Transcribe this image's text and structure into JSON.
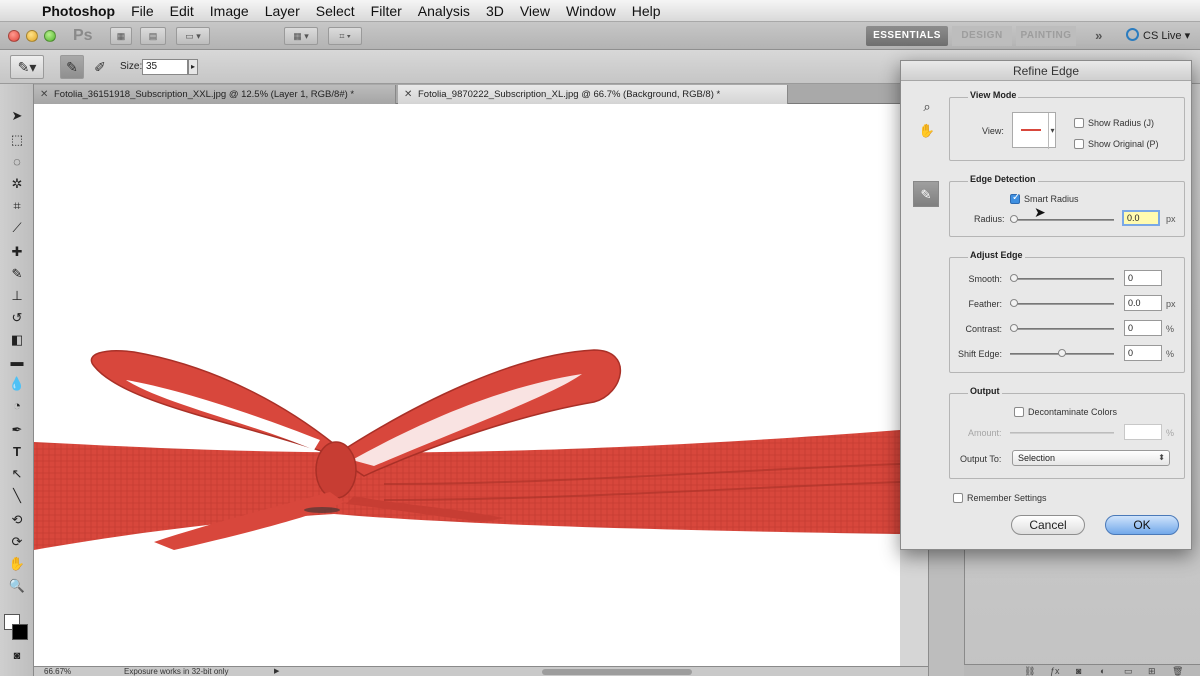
{
  "menubar": {
    "app_name": "Photoshop",
    "items": [
      "File",
      "Edit",
      "Image",
      "Layer",
      "Select",
      "Filter",
      "Analysis",
      "3D",
      "View",
      "Window",
      "Help"
    ]
  },
  "appbar": {
    "logo": "Ps",
    "workspace_active": "ESSENTIALS",
    "workspace_design": "DESIGN",
    "workspace_painting": "PAINTING",
    "more": "»",
    "cs_live": "CS Live"
  },
  "options": {
    "size_label": "Size:",
    "size_value": "35"
  },
  "tabs": [
    {
      "label": "Fotolia_36151918_Subscription_XXL.jpg @ 12.5% (Layer 1, RGB/8#) *"
    },
    {
      "label": "Fotolia_9870222_Subscription_XL.jpg @ 66.7% (Background, RGB/8) *"
    }
  ],
  "status": {
    "zoom": "66.67%",
    "message": "Exposure works in 32-bit only"
  },
  "dialog": {
    "title": "Refine Edge",
    "view_mode": {
      "title": "View Mode",
      "view_label": "View:",
      "show_radius": "Show Radius (J)",
      "show_original": "Show Original (P)",
      "show_radius_checked": false,
      "show_original_checked": false
    },
    "edge_detection": {
      "title": "Edge Detection",
      "smart_radius": "Smart Radius",
      "smart_radius_checked": true,
      "radius_label": "Radius:",
      "radius_value": "0.0",
      "radius_unit": "px",
      "radius_level": 0
    },
    "adjust_edge": {
      "title": "Adjust Edge",
      "rows": [
        {
          "label": "Smooth:",
          "value": "0",
          "unit": "",
          "level": 0
        },
        {
          "label": "Feather:",
          "value": "0.0",
          "unit": "px",
          "level": 0
        },
        {
          "label": "Contrast:",
          "value": "0",
          "unit": "%",
          "level": 0
        },
        {
          "label": "Shift Edge:",
          "value": "0",
          "unit": "%",
          "level": 0.5
        }
      ]
    },
    "output": {
      "title": "Output",
      "decontaminate": "Decontaminate Colors",
      "decontaminate_checked": false,
      "amount_label": "Amount:",
      "amount_unit": "%",
      "output_to_label": "Output To:",
      "output_to_value": "Selection"
    },
    "remember": "Remember Settings",
    "remember_checked": false,
    "cancel": "Cancel",
    "ok": "OK"
  },
  "colors": {
    "ribbon": "#d8473c",
    "ribbon_dark": "#a93027",
    "ok_button": "#72a8ea"
  },
  "icons": {
    "apple": "apple-icon",
    "zoom": "zoom-icon",
    "hand": "hand-icon",
    "brush": "refine-radius-brush-icon"
  }
}
